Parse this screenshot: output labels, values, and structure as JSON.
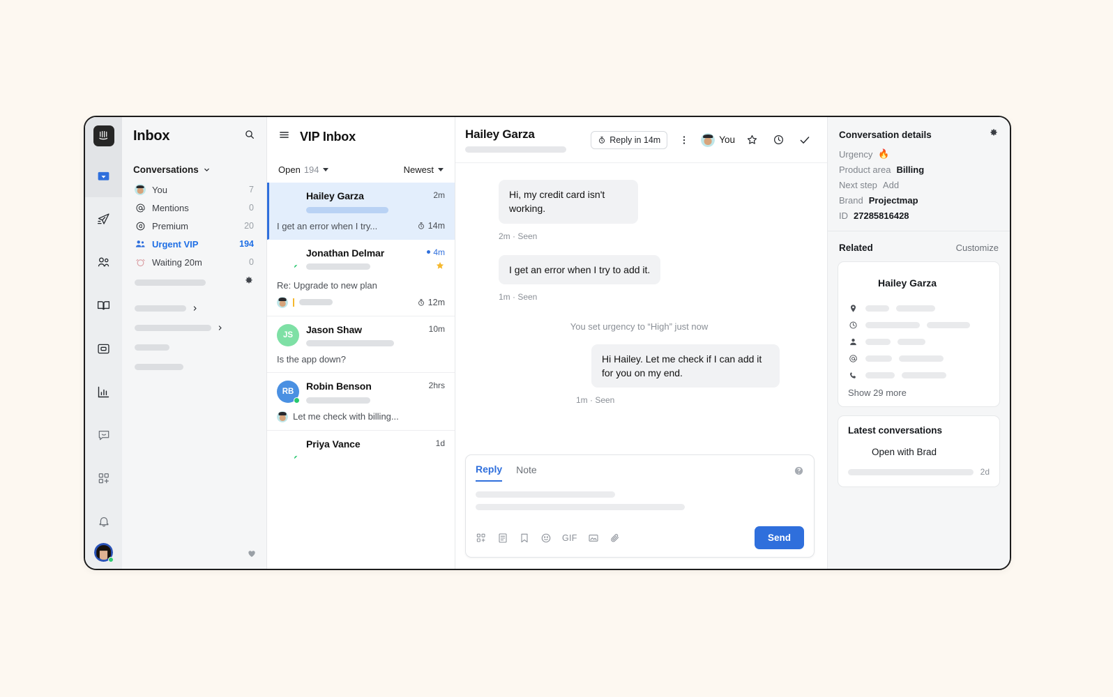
{
  "rail": {
    "logo": "intercom-logo",
    "items": [
      {
        "icon": "inbox-icon",
        "active": true
      },
      {
        "icon": "paper-plane-icon",
        "active": false
      },
      {
        "icon": "contacts-icon",
        "active": false
      },
      {
        "icon": "book-icon",
        "active": false
      },
      {
        "icon": "articles-icon",
        "active": false
      },
      {
        "icon": "reports-bar-chart-icon",
        "active": false
      }
    ],
    "bottom_items": [
      {
        "icon": "messenger-icon"
      },
      {
        "icon": "apps-add-icon"
      },
      {
        "icon": "bell-icon"
      }
    ],
    "avatar": "user-avatar"
  },
  "sidebar": {
    "title": "Inbox",
    "search_icon": "search-icon",
    "group_label": "Conversations",
    "items": [
      {
        "label": "You",
        "count": "7",
        "icon": "avatar",
        "active": false
      },
      {
        "label": "Mentions",
        "count": "0",
        "icon": "at-icon",
        "active": false
      },
      {
        "label": "Premium",
        "count": "20",
        "icon": "at-circle-icon",
        "active": false
      },
      {
        "label": "Urgent VIP",
        "count": "194",
        "icon": "people-icon",
        "active": true
      },
      {
        "label": "Waiting 20m",
        "count": "0",
        "icon": "alarm-icon",
        "active": false
      }
    ],
    "settings_icon": "gear-icon",
    "favorite_icon": "heart-icon"
  },
  "list": {
    "menu_icon": "hamburger-menu-icon",
    "title": "VIP Inbox",
    "filter_state": "Open",
    "filter_count": "194",
    "sort": "Newest",
    "conversations": [
      {
        "name": "Hailey Garza",
        "time": "2m",
        "preview": "I get an error when I try...",
        "sla": "14m",
        "selected": true,
        "unread": false,
        "starred": false,
        "online": false,
        "avatar_kind": "photo-hailey"
      },
      {
        "name": "Jonathan Delmar",
        "time": "4m",
        "preview": "Re: Upgrade to new plan",
        "sla": "12m",
        "selected": false,
        "unread": true,
        "starred": true,
        "online": true,
        "avatar_kind": "photo-jon",
        "has_draft": true
      },
      {
        "name": "Jason Shaw",
        "time": "10m",
        "preview": "Is the app down?",
        "sla": "",
        "selected": false,
        "unread": false,
        "starred": false,
        "online": false,
        "avatar_kind": "initials",
        "initials": "JS",
        "initials_bg": "#7ee0a5"
      },
      {
        "name": "Robin Benson",
        "time": "2hrs",
        "preview": "Let me check with billing...",
        "sla": "",
        "selected": false,
        "unread": false,
        "starred": false,
        "online": true,
        "avatar_kind": "initials",
        "initials": "RB",
        "initials_bg": "#4a90e2",
        "preview_has_avatar": true
      },
      {
        "name": "Priya Vance",
        "time": "1d",
        "preview": "",
        "sla": "",
        "selected": false,
        "unread": false,
        "starred": false,
        "online": true,
        "avatar_kind": "photo-priya"
      }
    ]
  },
  "conversation": {
    "contact_name": "Hailey Garza",
    "reply_sla": "Reply in 14m",
    "reply_sla_icon": "stopwatch-icon",
    "more_icon": "more-vertical-icon",
    "assignee": "You",
    "star_icon": "star-icon",
    "snooze_icon": "clock-icon",
    "close_icon": "checkmark-icon",
    "messages": [
      {
        "from": "contact",
        "text": "Hi, my credit card isn't working.",
        "meta": "2m · Seen"
      },
      {
        "from": "contact",
        "text": "I get an error when I try to add it.",
        "meta": "1m · Seen"
      },
      {
        "from": "system",
        "text": "You set urgency to “High” just now"
      },
      {
        "from": "agent",
        "text": "Hi Hailey. Let me check if I can add it for you on my end.",
        "meta": "1m · Seen"
      }
    ],
    "composer": {
      "tabs": [
        {
          "label": "Reply",
          "active": true
        },
        {
          "label": "Note",
          "active": false
        }
      ],
      "help_icon": "help-circle-icon",
      "tools": [
        "macros-icon",
        "saved-reply-icon",
        "bookmark-icon",
        "emoji-icon",
        "gif-icon",
        "image-icon",
        "attachment-icon"
      ],
      "gif_label": "GIF",
      "send_label": "Send"
    }
  },
  "details": {
    "section_title": "Conversation details",
    "gear_icon": "gear-icon",
    "attributes": [
      {
        "key": "Urgency",
        "value": "🔥",
        "style": "emoji"
      },
      {
        "key": "Product area",
        "value": "Billing",
        "style": "bold"
      },
      {
        "key": "Next step",
        "value": "Add",
        "style": "muted"
      },
      {
        "key": "Brand",
        "value": "Projectmap",
        "style": "bold"
      },
      {
        "key": "ID",
        "value": "27285816428",
        "style": "bold"
      }
    ],
    "related_title": "Related",
    "customize_label": "Customize",
    "person": {
      "name": "Hailey Garza",
      "attribute_icons": [
        "location-pin-icon",
        "clock-icon",
        "person-icon",
        "at-icon",
        "phone-icon"
      ],
      "show_more": "Show 29 more"
    },
    "latest": {
      "title": "Latest conversations",
      "items": [
        {
          "label": "Open with Brad",
          "time": "2d",
          "avatar": "brad-avatar"
        }
      ]
    }
  },
  "colors": {
    "accent": "#2f6fdc",
    "selected_bg": "#e3eefc",
    "page_bg": "#fdf8f1",
    "rail_bg": "#eceef0",
    "sidebar_bg": "#f5f6f7",
    "online": "#28c76f",
    "star": "#f5b82e"
  }
}
